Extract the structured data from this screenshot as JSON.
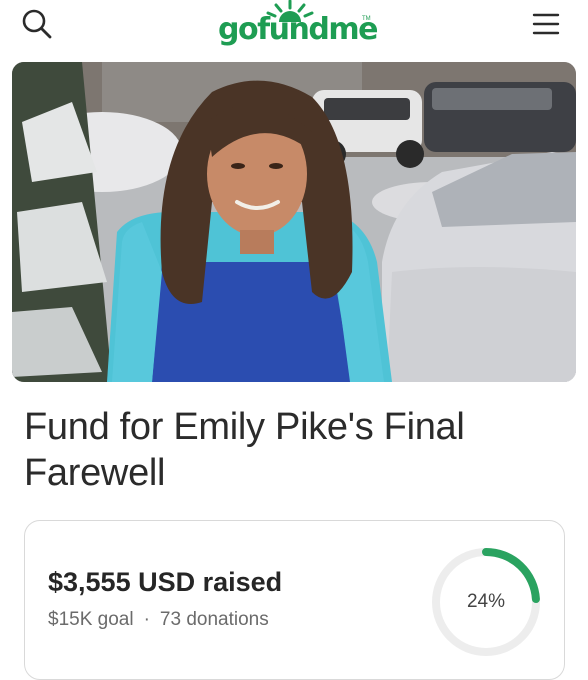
{
  "header": {
    "logo_text": "gofundme",
    "logo_tm": "TM",
    "icons": {
      "search": "search-icon",
      "menu": "hamburger-menu-icon"
    }
  },
  "campaign": {
    "title": "Fund for Emily Pike's Final Farewell",
    "amount_raised": "$3,555 USD raised",
    "goal": "$15K goal",
    "separator": "·",
    "donations": "73 donations",
    "progress_fraction": 0.24,
    "progress_label": "24%"
  },
  "colors": {
    "brand_green": "#1e9d53",
    "progress_track": "#ededed",
    "progress_fill": "#2aa360"
  }
}
